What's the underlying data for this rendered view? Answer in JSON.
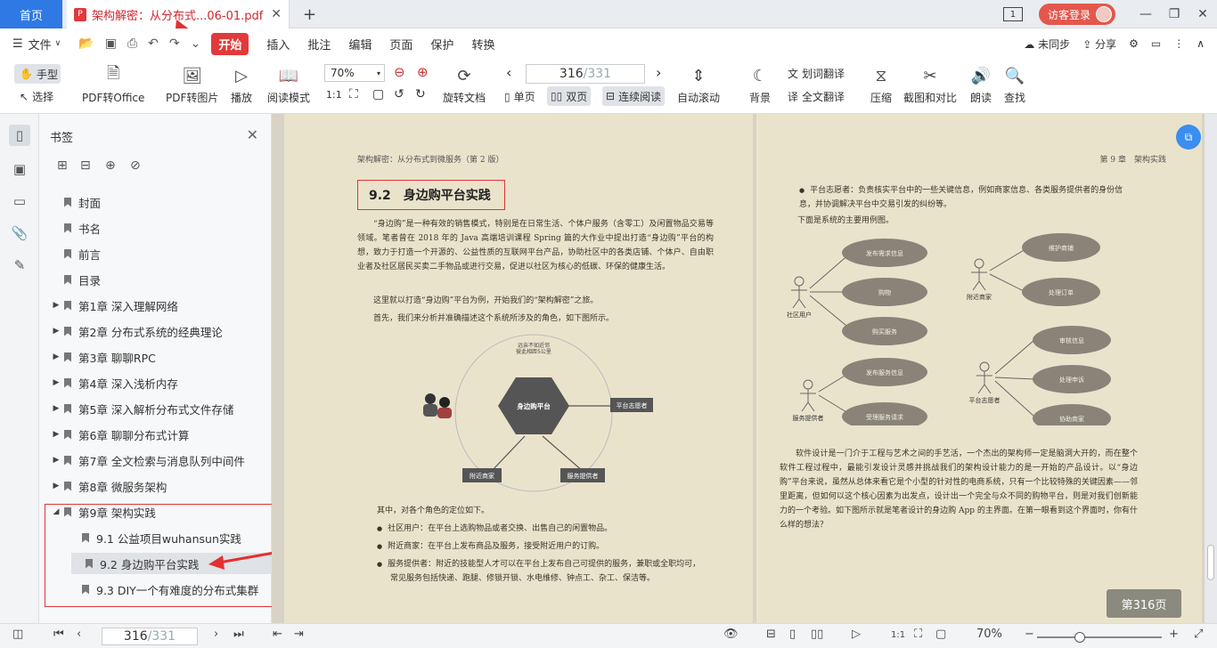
{
  "tabs": {
    "home": "首页",
    "doc_title": "架构解密：从分布式...06-01.pdf",
    "doc_badge": "P",
    "close": "✕",
    "new_tab": "+"
  },
  "window": {
    "page_count_icon": "1",
    "login": "访客登录",
    "minimize": "—",
    "restore": "❐",
    "close": "✕"
  },
  "menu": {
    "file": "文件",
    "items": [
      "开始",
      "插入",
      "批注",
      "编辑",
      "页面",
      "保护",
      "转换"
    ],
    "sync": "未同步",
    "share": "分享"
  },
  "toolbar": {
    "hand": "手型",
    "select": "选择",
    "pdf2office": "PDF转Office",
    "pdf2img": "PDF转图片",
    "play": "播放",
    "read_mode": "阅读模式",
    "zoom": "70%",
    "rotate": "旋转文档",
    "single": "单页",
    "double": "双页",
    "continuous": "连续阅读",
    "auto_scroll": "自动滚动",
    "background": "背景",
    "word_translate": "划词翻译",
    "full_translate": "全文翻译",
    "compress": "压缩",
    "screenshot": "截图和对比",
    "read_aloud": "朗读",
    "find": "查找",
    "page_current": "316",
    "page_total": "/331"
  },
  "panel": {
    "title": "书签",
    "bookmarks": [
      {
        "label": "封面",
        "level": 0,
        "arrow": ""
      },
      {
        "label": "书名",
        "level": 0,
        "arrow": ""
      },
      {
        "label": "前言",
        "level": 0,
        "arrow": ""
      },
      {
        "label": "目录",
        "level": 0,
        "arrow": ""
      },
      {
        "label": "第1章 深入理解网络",
        "level": 0,
        "arrow": "▶"
      },
      {
        "label": "第2章 分布式系统的经典理论",
        "level": 0,
        "arrow": "▶"
      },
      {
        "label": "第3章 聊聊RPC",
        "level": 0,
        "arrow": "▶"
      },
      {
        "label": "第4章 深入浅析内存",
        "level": 0,
        "arrow": "▶"
      },
      {
        "label": "第5章 深入解析分布式文件存储",
        "level": 0,
        "arrow": "▶"
      },
      {
        "label": "第6章 聊聊分布式计算",
        "level": 0,
        "arrow": "▶"
      },
      {
        "label": "第7章 全文检索与消息队列中间件",
        "level": 0,
        "arrow": "▶"
      },
      {
        "label": "第8章 微服务架构",
        "level": 0,
        "arrow": "▶"
      },
      {
        "label": "第9章 架构实践",
        "level": 0,
        "arrow": "◢"
      },
      {
        "label": "9.1 公益项目wuhansun实践",
        "level": 1,
        "arrow": ""
      },
      {
        "label": "9.2 身边购平台实践",
        "level": 1,
        "arrow": "",
        "selected": true
      },
      {
        "label": "9.3 DIY一个有难度的分布式集群",
        "level": 1,
        "arrow": ""
      }
    ]
  },
  "page_left": {
    "header": "架构解密：从分布式到微服务（第 2 版）",
    "section": "9.2　身边购平台实践",
    "p1": "“身边购”是一种有效的销售模式，特别是在日常生活、个体户服务（含零工）及闲置物品交易等领域。笔者曾在 2018 年的 Java 高端培训课程 Spring 篇的大作业中提出打造“身边购”平台的构想，致力于打造一个开源的、公益性质的互联网平台产品，协助社区中的各类店铺、个体户、自由职业者及社区居民买卖二手物品或进行交易，促进以社区为核心的低碳、环保的健康生活。",
    "p2": "这里就以打造“身边购”平台为例，开始我们的“架构解密”之旅。",
    "p3": "首先，我们来分析并准确描述这个系统所涉及的角色，如下图所示。",
    "diagram": {
      "center": "身边购平台",
      "top_note1": "远亲不如近邻",
      "top_note2": "彼此相距5公里",
      "volunteer": "平台志愿者",
      "merchant": "附近商家",
      "provider": "服务提供者"
    },
    "p4": "其中，对各个角色的定位如下。",
    "bullets": [
      "社区用户：在平台上选购物品或者交换、出售自己的闲置物品。",
      "附近商家：在平台上发布商品及服务，接受附近用户的订购。",
      "服务提供者：附近的技能型人才可以在平台上发布自己可提供的服务，兼职或全职均可，",
      "常见服务包括快递、跑腿、修锁开锁、水电维修、钟点工、杂工、保洁等。"
    ]
  },
  "page_right": {
    "header": "第 9 章　架构实践",
    "bullet1": "平台志愿者：负责核实平台中的一些关键信息，例如商家信息、各类服务提供者的身份信息，并协调解决平台中交易引发的纠纷等。",
    "intro": "下面是系统的主要用例图。",
    "uc": {
      "community_user": "社区用户",
      "uc1": [
        "发布需求信息",
        "购物",
        "购买服务"
      ],
      "merchant": "附近商家",
      "uc2": [
        "维护商铺",
        "处理订单"
      ],
      "provider": "服务提供者",
      "uc3": [
        "发布服务信息",
        "受理服务请求"
      ],
      "volunteer": "平台志愿者",
      "uc4": [
        "审核信息",
        "处理申诉",
        "协助商家"
      ]
    },
    "p_final": "软件设计是一门介于工程与艺术之间的手艺活，一个杰出的架构师一定是脑洞大开的，而在整个软件工程过程中，最能引发设计灵感并挑战我们的架构设计能力的是一开始的产品设计。以“身边购”平台来说，虽然从总体来看它是个小型的针对性的电商系统，只有一个比较特殊的关键因素——邻里距离，但如何以这个核心因素为出发点，设计出一个完全与众不同的购物平台，则是对我们创新能力的一个考验。如下图所示就是笔者设计的身边购 App 的主界面。在第一眼看到这个界面时，你有什么样的想法？",
    "page_badge": "第316页"
  },
  "statusbar": {
    "page_current": "316",
    "page_total": "/331",
    "zoom": "70%"
  }
}
